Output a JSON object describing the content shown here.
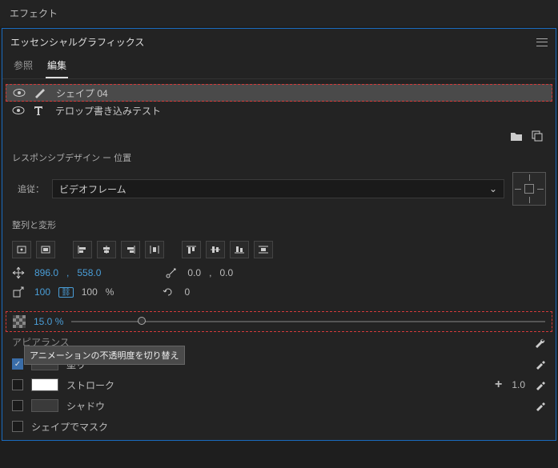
{
  "topTab": "エフェクト",
  "panel": {
    "title": "エッセンシャルグラフィックス",
    "tabs": {
      "browse": "参照",
      "edit": "編集"
    }
  },
  "layers": [
    {
      "name": "シェイプ 04",
      "selected": true,
      "iconType": "pen"
    },
    {
      "name": "テロップ書き込みテスト",
      "selected": false,
      "iconType": "text"
    }
  ],
  "responsive": {
    "title": "レスポンシブデザイン ー 位置",
    "trackLabel": "追従：",
    "trackValue": "ビデオフレーム"
  },
  "alignTransform": {
    "title": "整列と変形",
    "position": {
      "x": "896.0",
      "sep": ",",
      "y": "558.0"
    },
    "anchor": {
      "x": "0.0",
      "sep": ",",
      "y": "0.0"
    },
    "scale": {
      "w": "100",
      "h": "100",
      "unit": "%"
    },
    "rotation": "0",
    "opacity": "15.0 %"
  },
  "tooltip": "アニメーションの不透明度を切り替え",
  "appearance": {
    "title": "アピアランス",
    "fill": "塗り",
    "stroke": "ストローク",
    "strokeWidth": "1.0",
    "shadow": "シャドウ",
    "mask": "シェイプでマスク"
  }
}
